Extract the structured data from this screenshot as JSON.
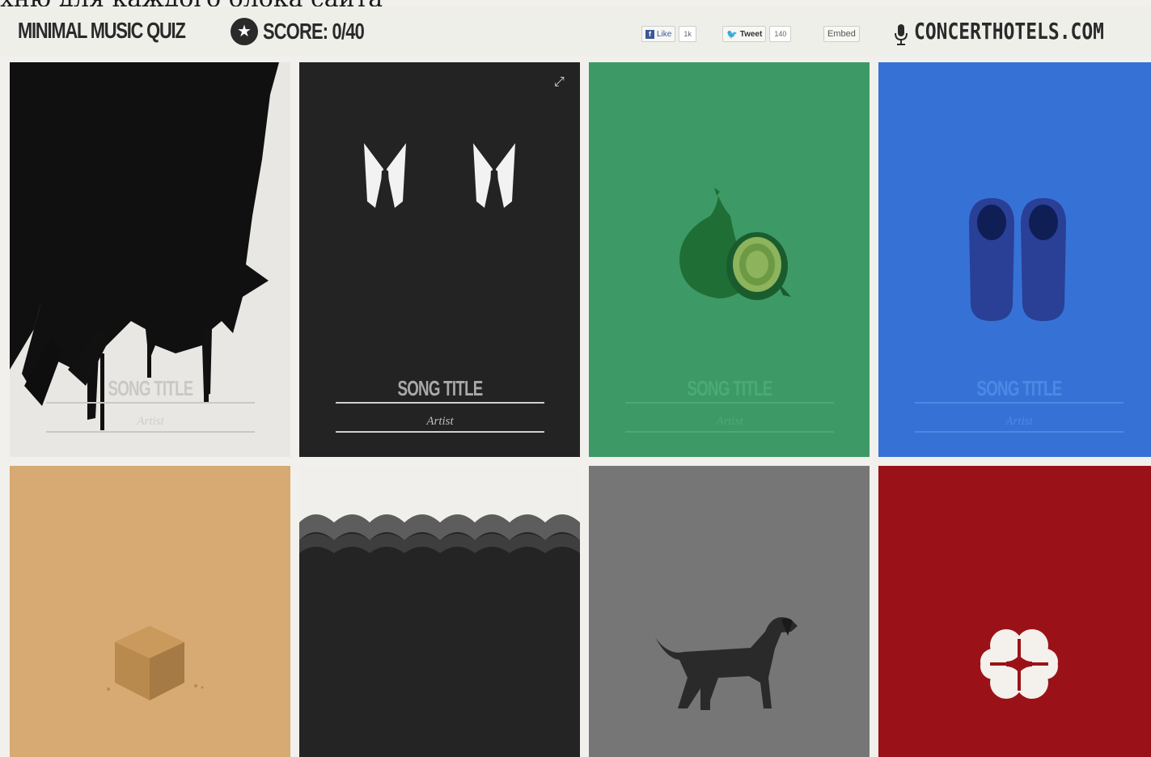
{
  "caption": "хню для каждого блока сайта",
  "header": {
    "title": "MINIMAL MUSIC QUIZ",
    "score_label": "SCORE: 0/40",
    "like_label": "Like",
    "like_count": "1k",
    "tweet_label": "Tweet",
    "tweet_count": "140",
    "embed_label": "Embed",
    "site_name": "CONCERTHOTELS.COM",
    "star_icon": "star-icon",
    "mic_icon": "microphone-icon"
  },
  "tiles": [
    {
      "icon": "piano-keys-drip",
      "song_title": "SONG TITLE",
      "artist": "Artist",
      "bg": "#e8e7e3"
    },
    {
      "icon": "shirt-collars",
      "song_title": "SONG TITLE",
      "artist": "Artist",
      "bg": "#232323"
    },
    {
      "icon": "onion",
      "song_title": "SONG TITLE",
      "artist": "Artist",
      "bg": "#3d9a66"
    },
    {
      "icon": "blue-shoes",
      "song_title": "SONG TITLE",
      "artist": "Artist",
      "bg": "#3672d6"
    },
    {
      "icon": "sugar-cube",
      "bg": "#d6aa72"
    },
    {
      "icon": "clouds-waves",
      "bg": "#242424"
    },
    {
      "icon": "dog",
      "bg": "#767676"
    },
    {
      "icon": "four-leaf-clover",
      "bg": "#9a1218"
    }
  ]
}
